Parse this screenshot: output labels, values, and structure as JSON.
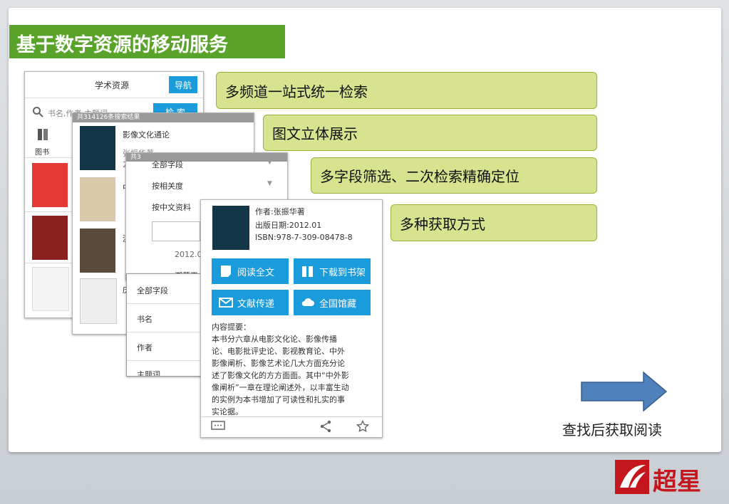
{
  "title": "基于数字资源的移动服务",
  "features": [
    "多频道一站式统一检索",
    "图文立体展示",
    "多字段筛选、二次检索精确定位",
    "多种获取方式"
  ],
  "search_screen": {
    "header": "学术资源",
    "nav_button": "导航",
    "search_placeholder": "书名,作者,主题词",
    "search_button": "检 索",
    "category_label": "图书"
  },
  "results_screen": {
    "result_count": "共314126条搜索结果",
    "first_title": "影像文化通论",
    "first_author": "张振华著",
    "year_prefix": "2",
    "row_chars": [
      "中",
      "湿",
      "庆"
    ],
    "partial_count": "共3"
  },
  "filter_screen": {
    "options": [
      "全部字段",
      "按相关度",
      "按中文资料"
    ],
    "year": "2012.0",
    "partial_title": "潮菜天"
  },
  "field_menu": {
    "items": [
      "全部字段",
      "书名",
      "作者",
      "主题词"
    ]
  },
  "detail_screen": {
    "author": "作者:张振华著",
    "pub_date": "出版日期:2012.01",
    "isbn": "ISBN:978-7-309-08478-8",
    "actions": [
      "阅读全文",
      "下载到书架",
      "文献传递",
      "全国馆藏"
    ],
    "summary_title": "内容提要：",
    "summary_lines": [
      "本书分六章从电影文化论、影像传播",
      "论、电影批评史论、影视教育论、中外",
      "影像阐析、影像艺术论几大方面充分论",
      "述了影像文化的方方面面。其中“中外影",
      "像阐析”一章在理论阐述外，以丰富生动",
      "的实例为本书增加了可读性和扎实的事",
      "实论据。"
    ]
  },
  "caption": "查找后获取阅读",
  "logo_text": "超星",
  "colors": {
    "title_green": "#59a32a",
    "feature_fill": "#d7e38e",
    "button_blue": "#1a9bdc",
    "arrow_blue": "#4f81bd",
    "logo_red": "#c4161c"
  }
}
